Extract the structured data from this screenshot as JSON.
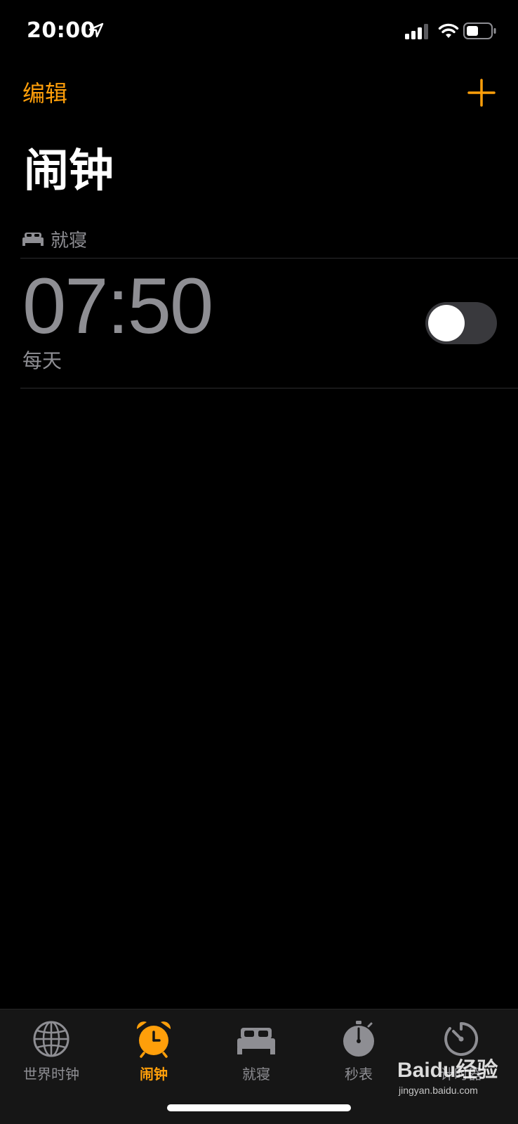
{
  "status_bar": {
    "time": "20:00",
    "icons": [
      "location-arrow-icon",
      "cellular-signal-icon",
      "wifi-icon",
      "battery-icon"
    ]
  },
  "nav": {
    "edit_label": "编辑",
    "add_icon": "plus-icon"
  },
  "page": {
    "title": "闹钟"
  },
  "section": {
    "label": "就寝",
    "icon": "bed-icon"
  },
  "alarm": {
    "time": "07:50",
    "repeat": "每天",
    "enabled": false
  },
  "tabs": [
    {
      "label": "世界时钟",
      "icon": "globe-icon",
      "active": false
    },
    {
      "label": "闹钟",
      "icon": "alarm-clock-icon",
      "active": true
    },
    {
      "label": "就寝",
      "icon": "bed-icon",
      "active": false
    },
    {
      "label": "秒表",
      "icon": "stopwatch-icon",
      "active": false
    },
    {
      "label": "计时器",
      "icon": "timer-icon",
      "active": false
    }
  ],
  "watermark": {
    "logo": "Baidu经验",
    "url": "jingyan.baidu.com"
  },
  "colors": {
    "accent": "#ff9f0a",
    "background": "#000000",
    "secondary_text": "#8e8e93",
    "toggle_off": "#39393d",
    "tab_bar": "#161616"
  }
}
